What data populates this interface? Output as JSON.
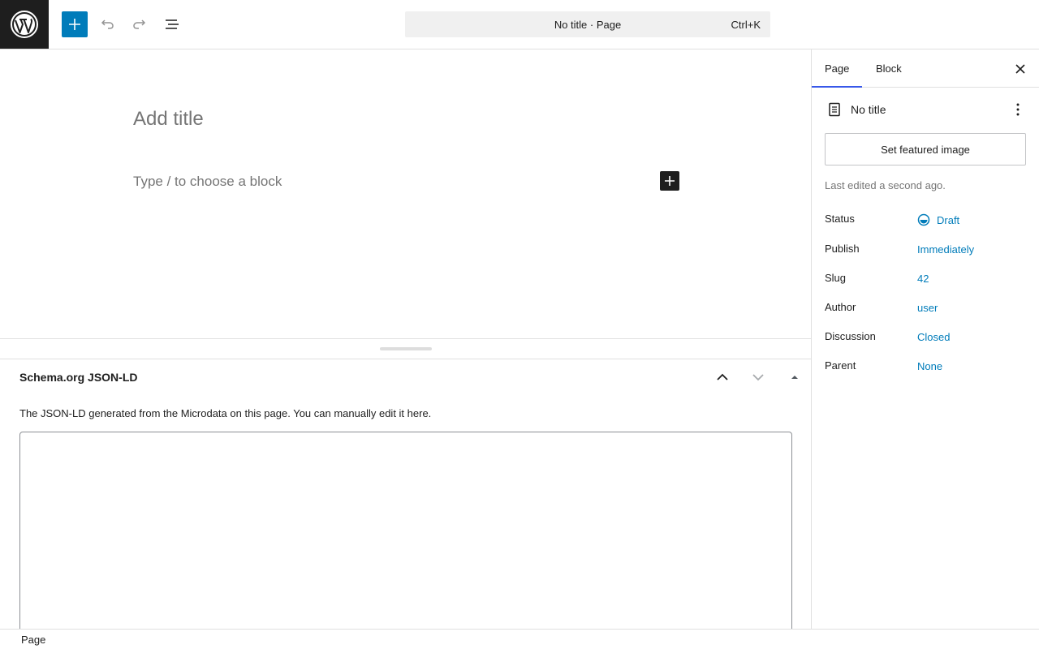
{
  "header": {
    "logo_icon": "wordpress-logo-icon",
    "inserter_icon": "plus-icon",
    "undo_icon": "undo-icon",
    "redo_icon": "redo-icon",
    "listview_icon": "list-view-icon",
    "command_bar": {
      "title": "No title · Page",
      "shortcut": "Ctrl+K"
    }
  },
  "editor": {
    "title_placeholder": "Add title",
    "block_placeholder": "Type / to choose a block"
  },
  "metabox": {
    "title": "Schema.org JSON-LD",
    "description": "The JSON-LD generated from the Microdata on this page. You can manually edit it here.",
    "textarea_value": ""
  },
  "footer": {
    "breadcrumb": "Page"
  },
  "sidebar": {
    "tabs": [
      {
        "label": "Page",
        "active": true
      },
      {
        "label": "Block",
        "active": false
      }
    ],
    "document_title": "No title",
    "featured_image_label": "Set featured image",
    "last_edited": "Last edited a second ago.",
    "fields": {
      "status": {
        "label": "Status",
        "value": "Draft"
      },
      "publish": {
        "label": "Publish",
        "value": "Immediately"
      },
      "slug": {
        "label": "Slug",
        "value": "42"
      },
      "author": {
        "label": "Author",
        "value": "user"
      },
      "discussion": {
        "label": "Discussion",
        "value": "Closed"
      },
      "parent": {
        "label": "Parent",
        "value": "None"
      }
    }
  },
  "colors": {
    "accent": "#007cba",
    "dark": "#1e1e1e",
    "tab_indicator": "#3858e9",
    "muted": "#757575"
  }
}
